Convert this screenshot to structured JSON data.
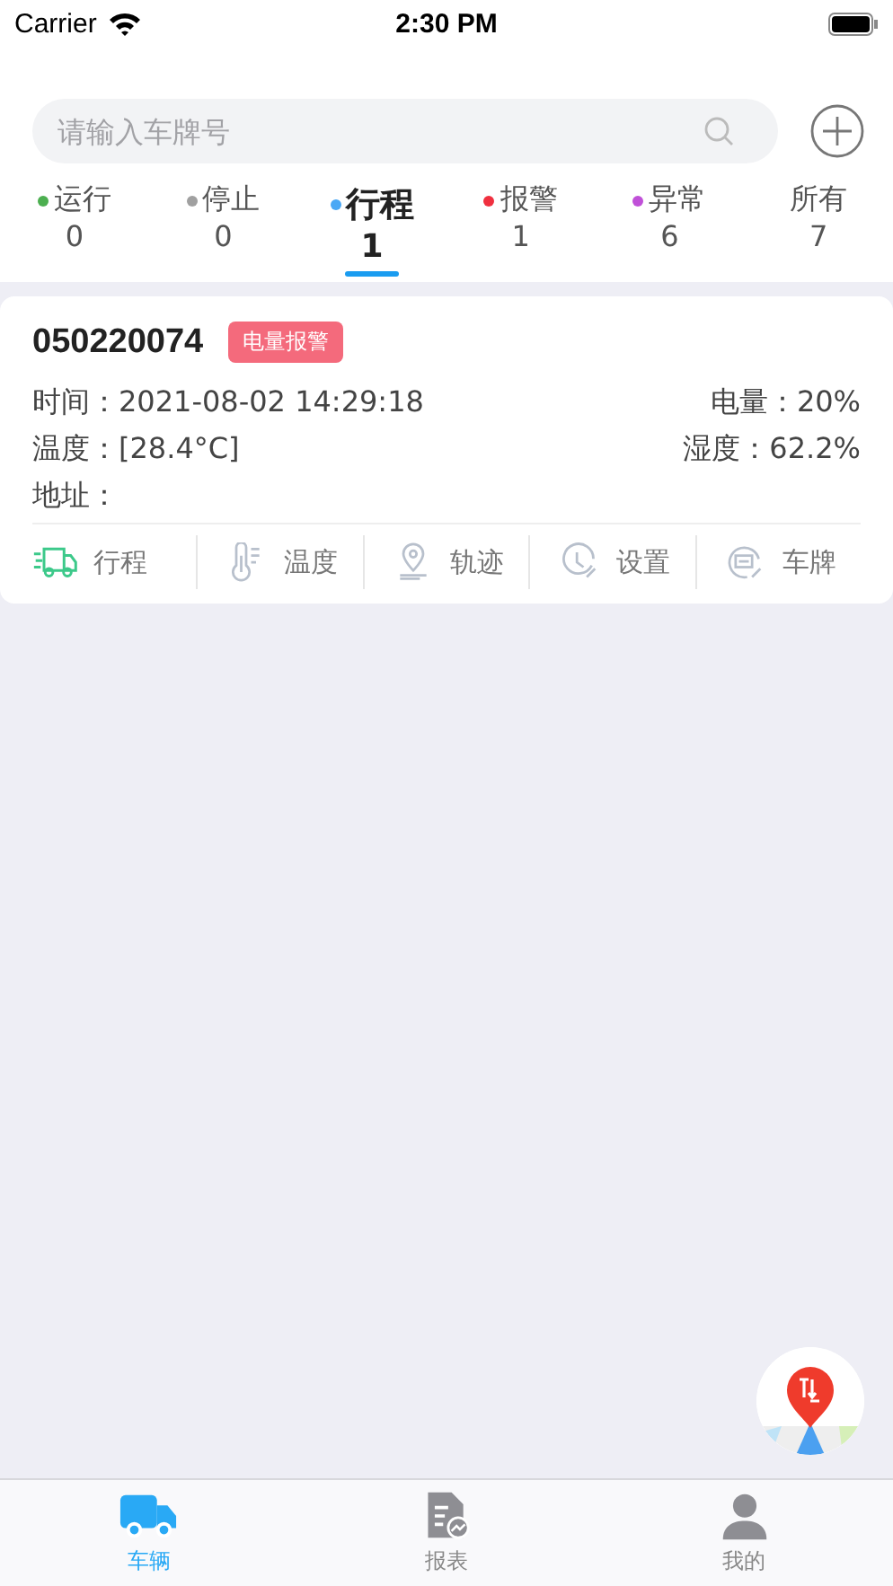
{
  "status_bar": {
    "carrier": "Carrier",
    "time": "2:30 PM"
  },
  "search": {
    "placeholder": "请输入车牌号"
  },
  "tabs": [
    {
      "label": "运行",
      "count": "0",
      "color": "#4caf50",
      "selected": false
    },
    {
      "label": "停止",
      "count": "0",
      "color": "#a0a0a0",
      "selected": false
    },
    {
      "label": "行程",
      "count": "1",
      "color": "#4aa8f5",
      "selected": true
    },
    {
      "label": "报警",
      "count": "1",
      "color": "#f0303f",
      "selected": false
    },
    {
      "label": "异常",
      "count": "6",
      "color": "#c050d8",
      "selected": false
    },
    {
      "label": "所有",
      "count": "7",
      "selected": false
    }
  ],
  "vehicles": [
    {
      "plate": "050220074",
      "badge": "电量报警",
      "fields": [
        {
          "label": "时间：",
          "value": "2021-08-02 14:29:18"
        },
        {
          "label": "电量：",
          "value": "20%"
        },
        {
          "label": "温度：",
          "value": "[28.4°C]"
        },
        {
          "label": "湿度：",
          "value": "62.2%"
        },
        {
          "label": "地址："
        }
      ],
      "actions": [
        {
          "kind": "truck",
          "label": "行程",
          "selected": true
        },
        {
          "kind": "thermometer",
          "label": "温度",
          "selected": false
        },
        {
          "kind": "pin",
          "label": "轨迹",
          "selected": false
        },
        {
          "kind": "clock",
          "label": "设置",
          "selected": false
        },
        {
          "kind": "plate",
          "label": "车牌",
          "selected": false
        }
      ]
    }
  ],
  "nav": [
    {
      "kind": "truck",
      "label": "车辆",
      "selected": true
    },
    {
      "kind": "report",
      "label": "报表",
      "selected": false
    },
    {
      "kind": "person",
      "label": "我的",
      "selected": false
    }
  ]
}
